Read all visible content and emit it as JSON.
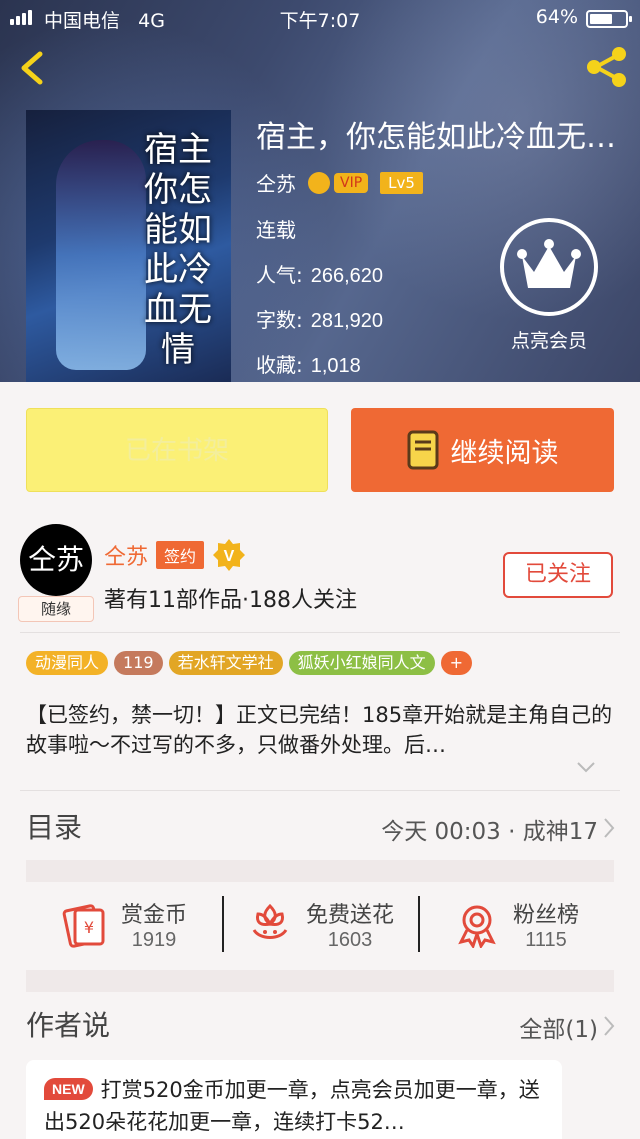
{
  "status_bar": {
    "carrier": "中国电信",
    "network": "4G",
    "time": "下午7:07",
    "battery": "64%"
  },
  "book": {
    "title": "宿主，你怎能如此冷血无…",
    "cover_title": "宿主你怎能如此冷血无情",
    "author": "仝苏",
    "vip_label": "VIP",
    "level": "Lv5",
    "status": "连载",
    "stats": [
      {
        "label": "人气:",
        "value": "266,620"
      },
      {
        "label": "字数:",
        "value": "281,920"
      },
      {
        "label": "收藏:",
        "value": "1,018"
      }
    ],
    "member_label": "点亮会员"
  },
  "buttons": {
    "shelf": "已在书架",
    "read": "继续阅读"
  },
  "author_block": {
    "avatar_text": "仝苏",
    "avatar_tag": "随缘",
    "name": "仝苏",
    "sign_badge": "签约",
    "v_badge": "V",
    "works": "著有11部作品·188人关注",
    "follow": "已关注"
  },
  "tags": [
    {
      "text": "动漫同人",
      "color": "#f3b227"
    },
    {
      "text": "119",
      "color": "#c57a5d"
    },
    {
      "text": "若水轩文学社",
      "color": "#e2a625"
    },
    {
      "text": "狐妖小红娘同人文",
      "color": "#8dbf45"
    },
    {
      "text": "+",
      "color": "#ef6934"
    }
  ],
  "description": "【已签约，禁一切！】正文已完结！185章开始就是主角自己的故事啦～不过写的不多，只做番外处理。后…",
  "toc": {
    "title": "目录",
    "latest": "今天 00:03 · 成神17"
  },
  "actions": [
    {
      "label": "赏金币",
      "count": "1919",
      "icon": "coin-card-icon"
    },
    {
      "label": "免费送花",
      "count": "1603",
      "icon": "flower-icon"
    },
    {
      "label": "粉丝榜",
      "count": "1115",
      "icon": "ribbon-medal-icon"
    }
  ],
  "author_talk": {
    "title": "作者说",
    "all": "全部(1)",
    "new_badge": "NEW",
    "text": "打赏520金币加更一章，点亮会员加更一章，送出520朵花花加更一章，连续打卡52…"
  },
  "colors": {
    "accent": "#ef6934",
    "shelf_bg": "#fbf076",
    "follow_red": "#e24a3b"
  }
}
